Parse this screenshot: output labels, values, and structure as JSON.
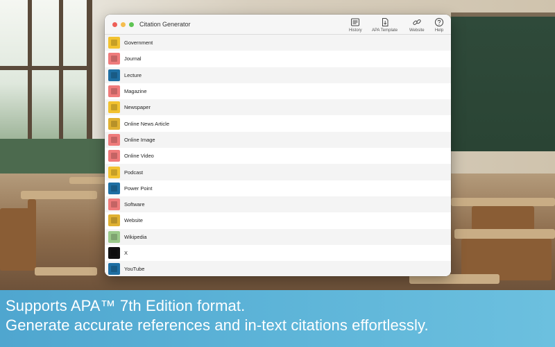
{
  "window": {
    "title": "Citation Generator"
  },
  "toolbar": [
    {
      "label": "History",
      "icon": "history-icon"
    },
    {
      "label": "APA Template",
      "icon": "document-icon"
    },
    {
      "label": "Website",
      "icon": "link-icon"
    },
    {
      "label": "Help",
      "icon": "help-icon"
    }
  ],
  "sources": [
    {
      "label": "Government",
      "tile_color": "#f2c230",
      "icon": "government-icon"
    },
    {
      "label": "Journal",
      "tile_color": "#ef7b7b",
      "icon": "journal-icon"
    },
    {
      "label": "Lecture",
      "tile_color": "#1f6fa3",
      "icon": "lecture-icon"
    },
    {
      "label": "Magazine",
      "tile_color": "#ef7b7b",
      "icon": "magazine-icon"
    },
    {
      "label": "Newspaper",
      "tile_color": "#f2c230",
      "icon": "newspaper-icon"
    },
    {
      "label": "Online News Article",
      "tile_color": "#e0b132",
      "icon": "news-article-icon"
    },
    {
      "label": "Online Image",
      "tile_color": "#ef7b7b",
      "icon": "image-icon"
    },
    {
      "label": "Online Video",
      "tile_color": "#ef7b7b",
      "icon": "video-icon"
    },
    {
      "label": "Podcast",
      "tile_color": "#f2c230",
      "icon": "podcast-icon"
    },
    {
      "label": "Power Point",
      "tile_color": "#1f6fa3",
      "icon": "presentation-icon"
    },
    {
      "label": "Software",
      "tile_color": "#ef7b7b",
      "icon": "software-icon"
    },
    {
      "label": "Website",
      "tile_color": "#e0b132",
      "icon": "website-icon"
    },
    {
      "label": "Wikipedia",
      "tile_color": "#9bc98a",
      "icon": "wikipedia-icon"
    },
    {
      "label": "X",
      "tile_color": "#111111",
      "icon": "x-logo-icon"
    },
    {
      "label": "YouTube",
      "tile_color": "#1f6fa3",
      "icon": "youtube-icon"
    }
  ],
  "caption": {
    "line1": "Supports APA™ 7th Edition format.",
    "line2": "Generate accurate references and in-text citations effortlessly."
  }
}
